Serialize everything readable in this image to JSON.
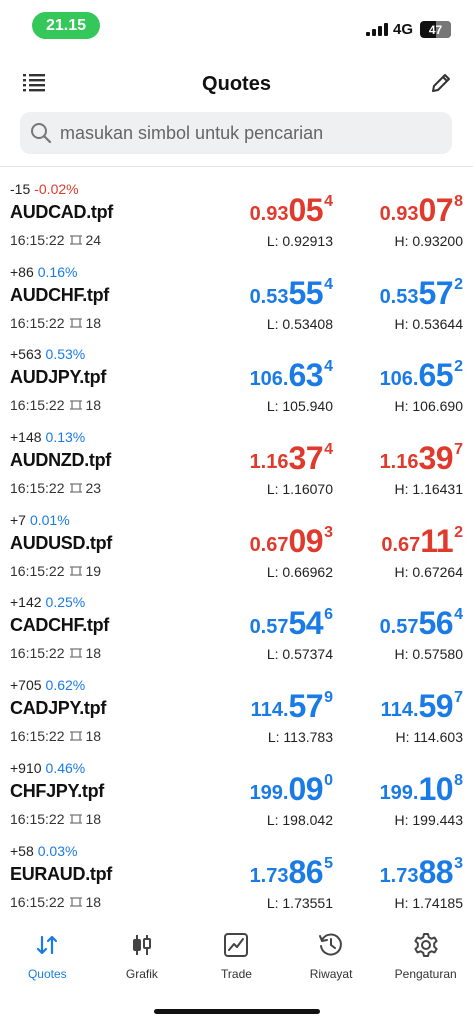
{
  "status_bar": {
    "time": "21.15",
    "network": "4G",
    "battery": "47"
  },
  "header": {
    "title": "Quotes",
    "menu_icon": "list-icon",
    "edit_icon": "pencil-icon"
  },
  "search": {
    "placeholder": "masukan simbol untuk pencarian"
  },
  "colors": {
    "up": "#1a7be6",
    "down": "#e03a2d",
    "time_pill": "#34c759"
  },
  "quotes": [
    {
      "change": "-15",
      "percent": "-0.02%",
      "direction": "down",
      "symbol": "AUDCAD.tpf",
      "time": "16:15:22",
      "spread": "24",
      "bid": {
        "small": "0.93",
        "big": "05",
        "sup": "4"
      },
      "ask": {
        "small": "0.93",
        "big": "07",
        "sup": "8"
      },
      "price_color": "red",
      "low": "L: 0.92913",
      "high": "H: 0.93200"
    },
    {
      "change": "+86",
      "percent": "0.16%",
      "direction": "up",
      "symbol": "AUDCHF.tpf",
      "time": "16:15:22",
      "spread": "18",
      "bid": {
        "small": "0.53",
        "big": "55",
        "sup": "4"
      },
      "ask": {
        "small": "0.53",
        "big": "57",
        "sup": "2"
      },
      "price_color": "blue",
      "low": "L: 0.53408",
      "high": "H: 0.53644"
    },
    {
      "change": "+563",
      "percent": "0.53%",
      "direction": "up",
      "symbol": "AUDJPY.tpf",
      "time": "16:15:22",
      "spread": "18",
      "bid": {
        "small": "106.",
        "big": "63",
        "sup": "4"
      },
      "ask": {
        "small": "106.",
        "big": "65",
        "sup": "2"
      },
      "price_color": "blue",
      "low": "L: 105.940",
      "high": "H: 106.690"
    },
    {
      "change": "+148",
      "percent": "0.13%",
      "direction": "up",
      "symbol": "AUDNZD.tpf",
      "time": "16:15:22",
      "spread": "23",
      "bid": {
        "small": "1.16",
        "big": "37",
        "sup": "4"
      },
      "ask": {
        "small": "1.16",
        "big": "39",
        "sup": "7"
      },
      "price_color": "red",
      "low": "L: 1.16070",
      "high": "H: 1.16431"
    },
    {
      "change": "+7",
      "percent": "0.01%",
      "direction": "up",
      "symbol": "AUDUSD.tpf",
      "time": "16:15:22",
      "spread": "19",
      "bid": {
        "small": "0.67",
        "big": "09",
        "sup": "3"
      },
      "ask": {
        "small": "0.67",
        "big": "11",
        "sup": "2"
      },
      "price_color": "red",
      "low": "L: 0.66962",
      "high": "H: 0.67264"
    },
    {
      "change": "+142",
      "percent": "0.25%",
      "direction": "up",
      "symbol": "CADCHF.tpf",
      "time": "16:15:22",
      "spread": "18",
      "bid": {
        "small": "0.57",
        "big": "54",
        "sup": "6"
      },
      "ask": {
        "small": "0.57",
        "big": "56",
        "sup": "4"
      },
      "price_color": "blue",
      "low": "L: 0.57374",
      "high": "H: 0.57580"
    },
    {
      "change": "+705",
      "percent": "0.62%",
      "direction": "up",
      "symbol": "CADJPY.tpf",
      "time": "16:15:22",
      "spread": "18",
      "bid": {
        "small": "114.",
        "big": "57",
        "sup": "9"
      },
      "ask": {
        "small": "114.",
        "big": "59",
        "sup": "7"
      },
      "price_color": "blue",
      "low": "L: 113.783",
      "high": "H: 114.603"
    },
    {
      "change": "+910",
      "percent": "0.46%",
      "direction": "up",
      "symbol": "CHFJPY.tpf",
      "time": "16:15:22",
      "spread": "18",
      "bid": {
        "small": "199.",
        "big": "09",
        "sup": "0"
      },
      "ask": {
        "small": "199.",
        "big": "10",
        "sup": "8"
      },
      "price_color": "blue",
      "low": "L: 198.042",
      "high": "H: 199.443"
    },
    {
      "change": "+58",
      "percent": "0.03%",
      "direction": "up",
      "symbol": "EURAUD.tpf",
      "time": "16:15:22",
      "spread": "18",
      "bid": {
        "small": "1.73",
        "big": "86",
        "sup": "5"
      },
      "ask": {
        "small": "1.73",
        "big": "88",
        "sup": "3"
      },
      "price_color": "blue",
      "low": "L: 1.73551",
      "high": "H: 1.74185"
    }
  ],
  "tabs": [
    {
      "label": "Quotes",
      "icon": "quotes-arrows-icon",
      "active": true
    },
    {
      "label": "Grafik",
      "icon": "candlestick-icon",
      "active": false
    },
    {
      "label": "Trade",
      "icon": "trade-chart-icon",
      "active": false
    },
    {
      "label": "Riwayat",
      "icon": "history-clock-icon",
      "active": false
    },
    {
      "label": "Pengaturan",
      "icon": "gear-icon",
      "active": false
    }
  ]
}
